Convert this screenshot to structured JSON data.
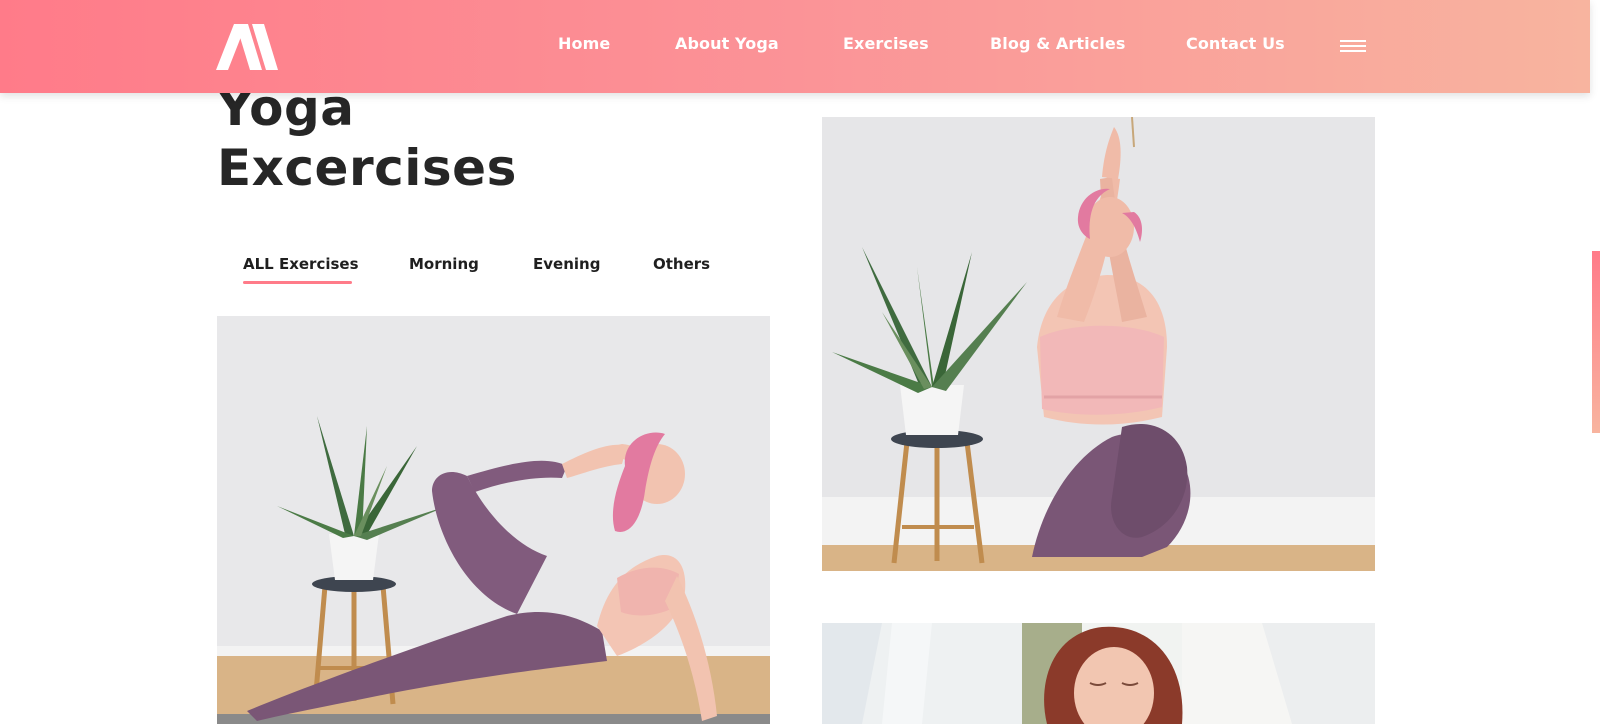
{
  "header": {
    "logo_icon": "m-logo-icon",
    "nav": {
      "home": "Home",
      "about": "About Yoga",
      "exercises": "Exercises",
      "blog": "Blog & Articles",
      "contact": "Contact Us"
    },
    "menu_icon": "hamburger-menu-icon",
    "gradient_start": "#ff7b89",
    "gradient_end": "#f8b49f"
  },
  "main": {
    "title_line1": "Yoga",
    "title_line2": "Excercises",
    "tabs": {
      "all": "ALL Exercises",
      "morning": "Morning",
      "evening": "Evening",
      "others": "Others"
    },
    "active_tab": "ALL Exercises",
    "accent_color": "#ff7b89"
  },
  "scroll": {
    "indicator_color": "#ff7b89"
  }
}
